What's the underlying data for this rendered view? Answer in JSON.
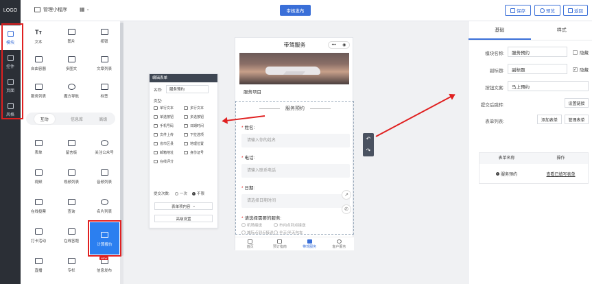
{
  "topbar": {
    "logo": "LOGO",
    "app_name": "管理小程序",
    "publish": "审核发布",
    "save": "保存",
    "preview": "预览",
    "back": "返回"
  },
  "leftnav": [
    {
      "label": "模块",
      "icon": "plus-square-icon"
    },
    {
      "label": "控件",
      "icon": "controls-icon"
    },
    {
      "label": "页面",
      "icon": "page-icon"
    },
    {
      "label": "风格",
      "icon": "style-icon"
    }
  ],
  "modules_basic": [
    "文本",
    "图片",
    "按钮",
    "自由容器",
    "多图文",
    "文章列表",
    "服务列表",
    "魔方导航",
    "标签"
  ],
  "module_tabs": [
    "互动",
    "信息库",
    "高级"
  ],
  "modules_interact": [
    "表单",
    "留言板",
    "关注公众号",
    "视频",
    "视频列表",
    "音频列表",
    "在线投票",
    "查询",
    "名片列表",
    "打卡活动",
    "在线答题",
    "计算报价",
    "直播",
    "专栏",
    "信息发布"
  ],
  "new_badge": "NEW",
  "edit_form": {
    "header": "编辑表单",
    "name_label": "名称:",
    "name_value": "服务预约",
    "type_label": "类型:",
    "types": [
      "单行文本",
      "多行文本",
      "单选按钮",
      "多选按钮",
      "手机号码",
      "日期时间",
      "文件上传",
      "下拉选项",
      "省市区县",
      "地理位置",
      "邮箱地址",
      "身份证号",
      "在线评分"
    ],
    "submit_times_label": "提交次数:",
    "submit_options": [
      "一次",
      "不限"
    ],
    "btn_items": "表单项内容",
    "btn_advanced": "高级设置"
  },
  "phone": {
    "title": "带驾服务",
    "item_label": "服务项目",
    "form_title": "服务预约",
    "fields": [
      {
        "label": "姓名:",
        "placeholder": "请输入你的姓名"
      },
      {
        "label": "电话:",
        "placeholder": "请输入联系电话"
      },
      {
        "label": "日期:",
        "placeholder": "请选择日期时间"
      }
    ],
    "choice_label": "请选择需要的服务:",
    "choices": [
      "机场接送",
      "市内点到点接送",
      "城际点到点接送",
      "全天/半天包车"
    ],
    "tabbar": [
      "首页",
      "预订指南",
      "带驾服务",
      "客户服务"
    ]
  },
  "rpanel": {
    "tab_basic": "基础",
    "tab_style": "样式",
    "module_name_label": "模块名称:",
    "module_name_value": "服务预约",
    "subtitle_label": "副标题:",
    "subtitle_value": "副标题",
    "button_text_label": "按钮文案:",
    "button_text_value": "马上预约",
    "jump_label": "提交后跳转:",
    "set_link": "设置链接",
    "list_label": "表单列表:",
    "add_form": "添加表单",
    "manage_form": "管理表单",
    "hide": "隐藏",
    "table_col_name": "表单名称",
    "table_col_op": "操作",
    "row_name": "服务预约",
    "row_op": "查看已填写表单"
  },
  "colors": {
    "accent": "#3a6fd8",
    "highlight": "#2b7ff0",
    "red": "#e02020",
    "dark": "#2b2f36"
  }
}
